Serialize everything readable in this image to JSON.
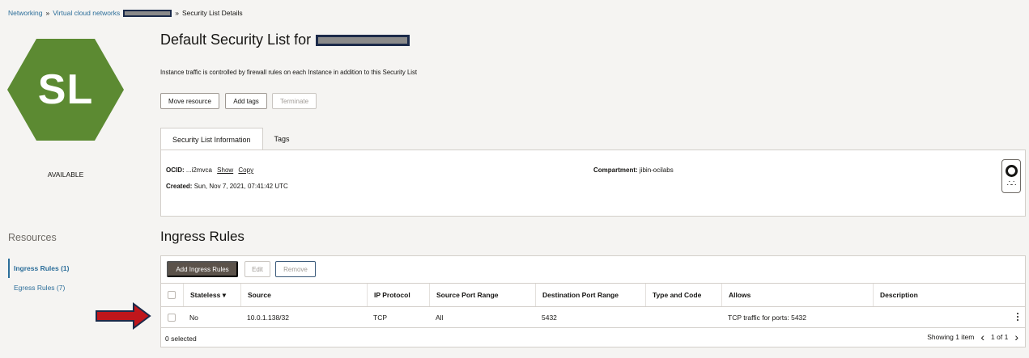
{
  "breadcrumb": {
    "items": [
      "Networking",
      "Virtual cloud networks"
    ],
    "separator": "»",
    "current": "Security List Details"
  },
  "resource": {
    "icon_text": "SL",
    "status": "AVAILABLE",
    "title": "Default Security List for",
    "description": "Instance traffic is controlled by firewall rules on each Instance in addition to this Security List",
    "colors": {
      "hex": "#5c8a32",
      "link": "#2c6e9a",
      "primary_button": "#5b524a"
    }
  },
  "actions": {
    "move": "Move resource",
    "add_tags": "Add tags",
    "terminate": "Terminate"
  },
  "tabs": [
    "Security List Information",
    "Tags"
  ],
  "info": {
    "ocid_label": "OCID:",
    "ocid_value": "...i2mvca",
    "show": "Show",
    "copy": "Copy",
    "created_label": "Created:",
    "created_value": "Sun, Nov 7, 2021, 07:41:42 UTC",
    "compartment_label": "Compartment:",
    "compartment_value": "jibin-ocilabs"
  },
  "sidebar": {
    "title": "Resources",
    "items": [
      "Ingress Rules (1)",
      "Egress Rules (7)"
    ]
  },
  "ingress": {
    "title": "Ingress Rules",
    "add_button": "Add Ingress Rules",
    "edit_button": "Edit",
    "remove_button": "Remove",
    "columns": [
      "Stateless ▾",
      "Source",
      "IP Protocol",
      "Source Port Range",
      "Destination Port Range",
      "Type and Code",
      "Allows",
      "Description"
    ],
    "rows": [
      {
        "stateless": "No",
        "source": "10.0.1.138/32",
        "protocol": "TCP",
        "src_port": "All",
        "dst_port": "5432",
        "type_code": "",
        "allows": "TCP traffic for ports: 5432",
        "description": ""
      }
    ],
    "selected": "0 selected",
    "showing": "Showing 1 item",
    "pages": "1 of 1"
  },
  "icons": [
    "hexagon-sl-icon",
    "lifebuoy-icon",
    "kebab-menu-icon",
    "chevron-left-icon",
    "chevron-right-icon",
    "red-arrow-annotation"
  ]
}
